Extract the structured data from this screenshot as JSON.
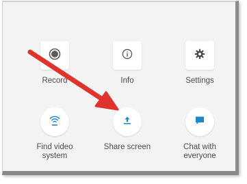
{
  "colors": {
    "accent": "#1e88c9",
    "arrow": "#e0332b",
    "label": "#4c4c4c",
    "panel": "#f3f3f3"
  },
  "items": [
    {
      "label": "Record",
      "icon": "record-icon",
      "shape": "square"
    },
    {
      "label": "Info",
      "icon": "info-icon",
      "shape": "square"
    },
    {
      "label": "Settings",
      "icon": "gear-icon",
      "shape": "square"
    },
    {
      "label": "Find video\nsystem",
      "icon": "proximity-icon",
      "shape": "round"
    },
    {
      "label": "Share screen",
      "icon": "upload-icon",
      "shape": "round"
    },
    {
      "label": "Chat with\neveryone",
      "icon": "chat-icon",
      "shape": "round"
    }
  ],
  "annotation": {
    "icon": "pointer-arrow-icon"
  }
}
